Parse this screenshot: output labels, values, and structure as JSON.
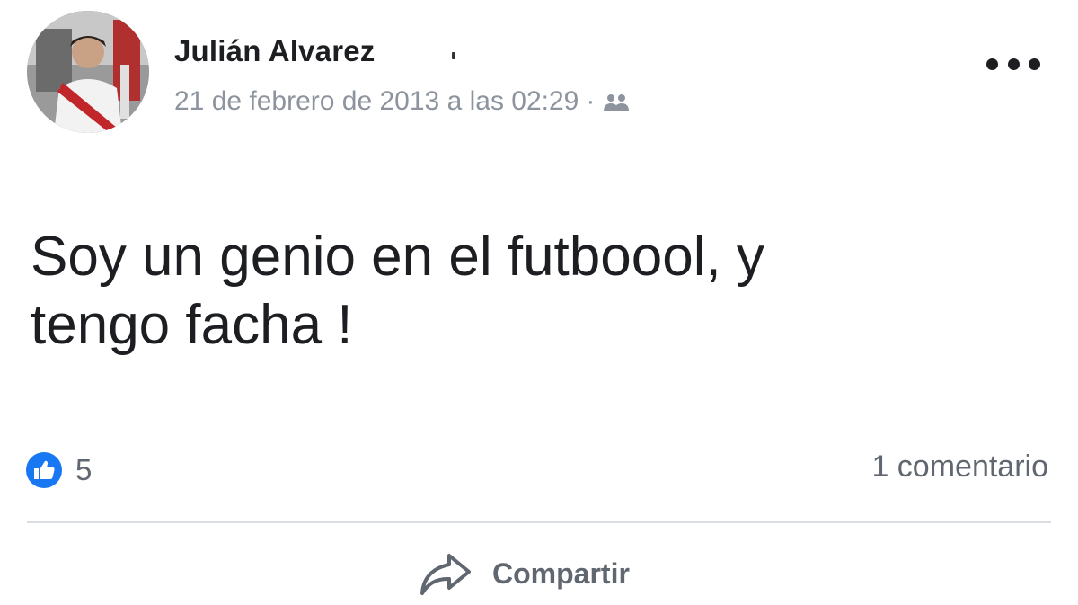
{
  "post": {
    "author": {
      "name": "Julián Alvarez",
      "avatar": "avatar-photo"
    },
    "meta": {
      "timestamp": "21 de febrero de 2013 a las 02:29",
      "separator": "·",
      "audience_icon": "friends-icon"
    },
    "more_icon": "more-options-icon",
    "text_lines": [
      "Soy un genio en el futboool, y",
      "tengo facha !"
    ],
    "reactions": {
      "icon": "like-icon",
      "count": "5"
    },
    "comments": {
      "label": "1 comentario"
    },
    "actions": {
      "share_label": "Compartir",
      "share_icon": "share-icon"
    },
    "colors": {
      "like_blue": "#1877f2",
      "meta_gray": "#8d949e",
      "text": "#1c1e21"
    }
  }
}
